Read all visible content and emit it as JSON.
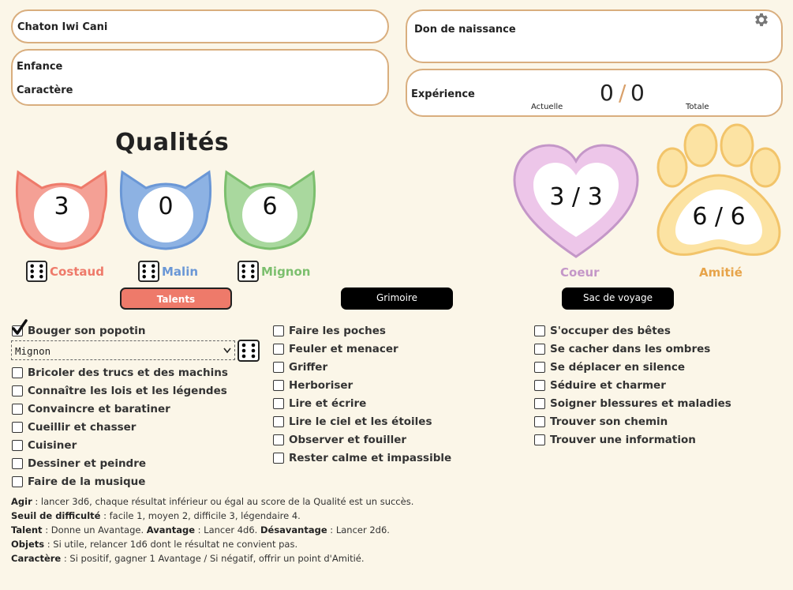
{
  "character": {
    "name": "Chaton Iwi Cani",
    "enfance_label": "Enfance",
    "caractere_label": "Caractère",
    "don_label": "Don de naissance",
    "experience_label": "Expérience",
    "experience_current": "0",
    "experience_sep": "/",
    "experience_total": "0",
    "experience_current_caption": "Actuelle",
    "experience_total_caption": "Totale"
  },
  "icons": {
    "settings": "gear-icon",
    "dice": "dice-six-icon",
    "check": "checkmark-icon",
    "select_arrow": "chevron-down-icon"
  },
  "qualities": {
    "title": "Qualités",
    "items": [
      {
        "name": "Costaud",
        "value": "3",
        "color": "#ee7a6a"
      },
      {
        "name": "Malin",
        "value": "0",
        "color": "#6a97d6"
      },
      {
        "name": "Mignon",
        "value": "6",
        "color": "#7cbf6e"
      }
    ]
  },
  "gauges": {
    "coeur": {
      "label": "Coeur",
      "value": "3 / 3",
      "color": "#c497c8"
    },
    "amitie": {
      "label": "Amitié",
      "value": "6 / 6",
      "color": "#e7a44a"
    }
  },
  "tabs": [
    {
      "label": "Talents",
      "active": true
    },
    {
      "label": "Grimoire",
      "active": false
    },
    {
      "label": "Sac de voyage",
      "active": false
    }
  ],
  "talents": {
    "col1": [
      {
        "label": "Bouger son popotin",
        "checked": true
      },
      {
        "label": "Bricoler des trucs et des machins",
        "checked": false
      },
      {
        "label": "Connaître les lois et les légendes",
        "checked": false
      },
      {
        "label": "Convaincre et baratiner",
        "checked": false
      },
      {
        "label": "Cueillir et chasser",
        "checked": false
      },
      {
        "label": "Cuisiner",
        "checked": false
      },
      {
        "label": "Dessiner et peindre",
        "checked": false
      },
      {
        "label": "Faire de la musique",
        "checked": false
      }
    ],
    "col2": [
      {
        "label": "Faire les poches",
        "checked": false
      },
      {
        "label": "Feuler et menacer",
        "checked": false
      },
      {
        "label": "Griffer",
        "checked": false
      },
      {
        "label": "Herboriser",
        "checked": false
      },
      {
        "label": "Lire et écrire",
        "checked": false
      },
      {
        "label": "Lire le ciel et les étoiles",
        "checked": false
      },
      {
        "label": "Observer et fouiller",
        "checked": false
      },
      {
        "label": "Rester calme et impassible",
        "checked": false
      }
    ],
    "col3": [
      {
        "label": "S'occuper des bêtes",
        "checked": false
      },
      {
        "label": "Se cacher dans les ombres",
        "checked": false
      },
      {
        "label": "Se déplacer en silence",
        "checked": false
      },
      {
        "label": "Séduire et charmer",
        "checked": false
      },
      {
        "label": "Soigner blessures et maladies",
        "checked": false
      },
      {
        "label": "Trouver son chemin",
        "checked": false
      },
      {
        "label": "Trouver une information",
        "checked": false
      }
    ],
    "selected_quality": "Mignon"
  },
  "rules": {
    "agir_term": "Agir",
    "agir_text": " : lancer 3d6, chaque résultat inférieur ou égal au score de la Qualité est un succès.",
    "seuil_term": "Seuil de difficulté",
    "seuil_text": " : facile 1, moyen 2, difficile 3, légendaire 4.",
    "talent_term": "Talent",
    "talent_text": " : Donne un Avantage. ",
    "avantage_term": "Avantage",
    "avantage_text": " : Lancer 4d6. ",
    "desavantage_term": "Désavantage",
    "desavantage_text": " : Lancer 2d6.",
    "objets_term": "Objets",
    "objets_text": " : Si utile, relancer 1d6 dont le résultat ne convient pas.",
    "caractere_term": "Caractère",
    "caractere_text": " : Si positif, gagner 1 Avantage / Si négatif, offrir un point d'Amitié."
  }
}
